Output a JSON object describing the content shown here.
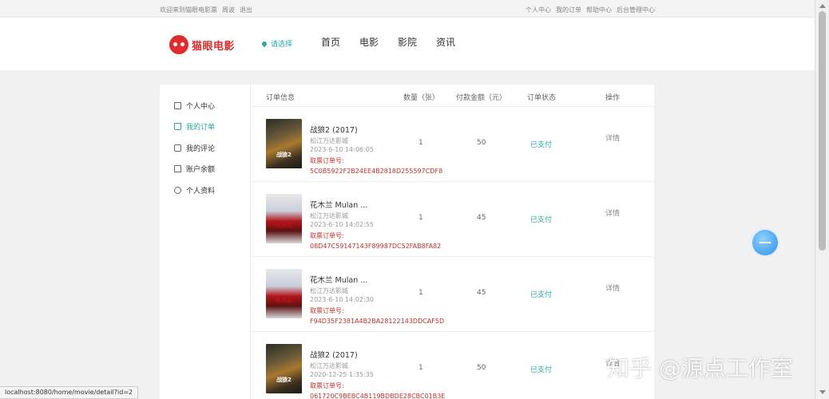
{
  "topbar": {
    "welcome": "欢迎来到猫眼电影票",
    "username": "周波",
    "logout": "退出",
    "links": [
      "个人中心",
      "我的订单",
      "帮助中心",
      "后台管理中心"
    ]
  },
  "header": {
    "logo_text": "猫眼电影",
    "city_placeholder": "请选择",
    "nav": [
      "首页",
      "电影",
      "影院",
      "资讯"
    ]
  },
  "sidebar": {
    "items": [
      {
        "label": "个人中心",
        "icon": "grid-icon",
        "active": false
      },
      {
        "label": "我的订单",
        "icon": "bag-icon",
        "active": true
      },
      {
        "label": "我的评论",
        "icon": "comment-icon",
        "active": false
      },
      {
        "label": "账户余额",
        "icon": "wallet-icon",
        "active": false
      },
      {
        "label": "个人资料",
        "icon": "user-icon",
        "active": false
      }
    ]
  },
  "orders": {
    "headers": {
      "info": "订单信息",
      "qty": "数量（张）",
      "amount": "付款金额（元）",
      "status": "订单状态",
      "action": "操作"
    },
    "rows": [
      {
        "poster": "战狼2",
        "title": "战狼2 (2017)",
        "cinema": "松江万达影城",
        "time": "2023-6-10 14:06:05",
        "code_label": "取票订单号:",
        "code": "5C0B5922F2B24EE4B2818D255597CDF8",
        "qty": "1",
        "amount": "50",
        "status": "已支付",
        "action": "详情"
      },
      {
        "poster": "花木兰",
        "title": "花木兰 Mulan ...",
        "cinema": "松江万达影城",
        "time": "2023-6-10 14:02:55",
        "code_label": "取票订单号:",
        "code": "08D47C59147143F89987DC52FAB8FA82",
        "qty": "1",
        "amount": "45",
        "status": "已支付",
        "action": "详情"
      },
      {
        "poster": "花木兰",
        "title": "花木兰 Mulan ...",
        "cinema": "松江万达影城",
        "time": "2023-6-10 14:02:30",
        "code_label": "取票订单号:",
        "code": "F94D35F2381A4B2BA28122143DDCAF5D",
        "qty": "1",
        "amount": "45",
        "status": "已支付",
        "action": "详情"
      },
      {
        "poster": "战狼2",
        "title": "战狼2 (2017)",
        "cinema": "松江万达影城",
        "time": "2020-12-25 1:35:35",
        "code_label": "取票订单号:",
        "code": "061720C9BEBC4B119BDBDE28CBC01B3E",
        "qty": "1",
        "amount": "50",
        "status": "已支付",
        "action": "详情"
      }
    ]
  },
  "status_url": "localhost:8080/home/movie/detail?id=2",
  "watermark": "知乎 @源点工作室",
  "colors": {
    "brand": "#df2d2d",
    "accent": "#2aa8a8",
    "code": "#c0312b"
  }
}
